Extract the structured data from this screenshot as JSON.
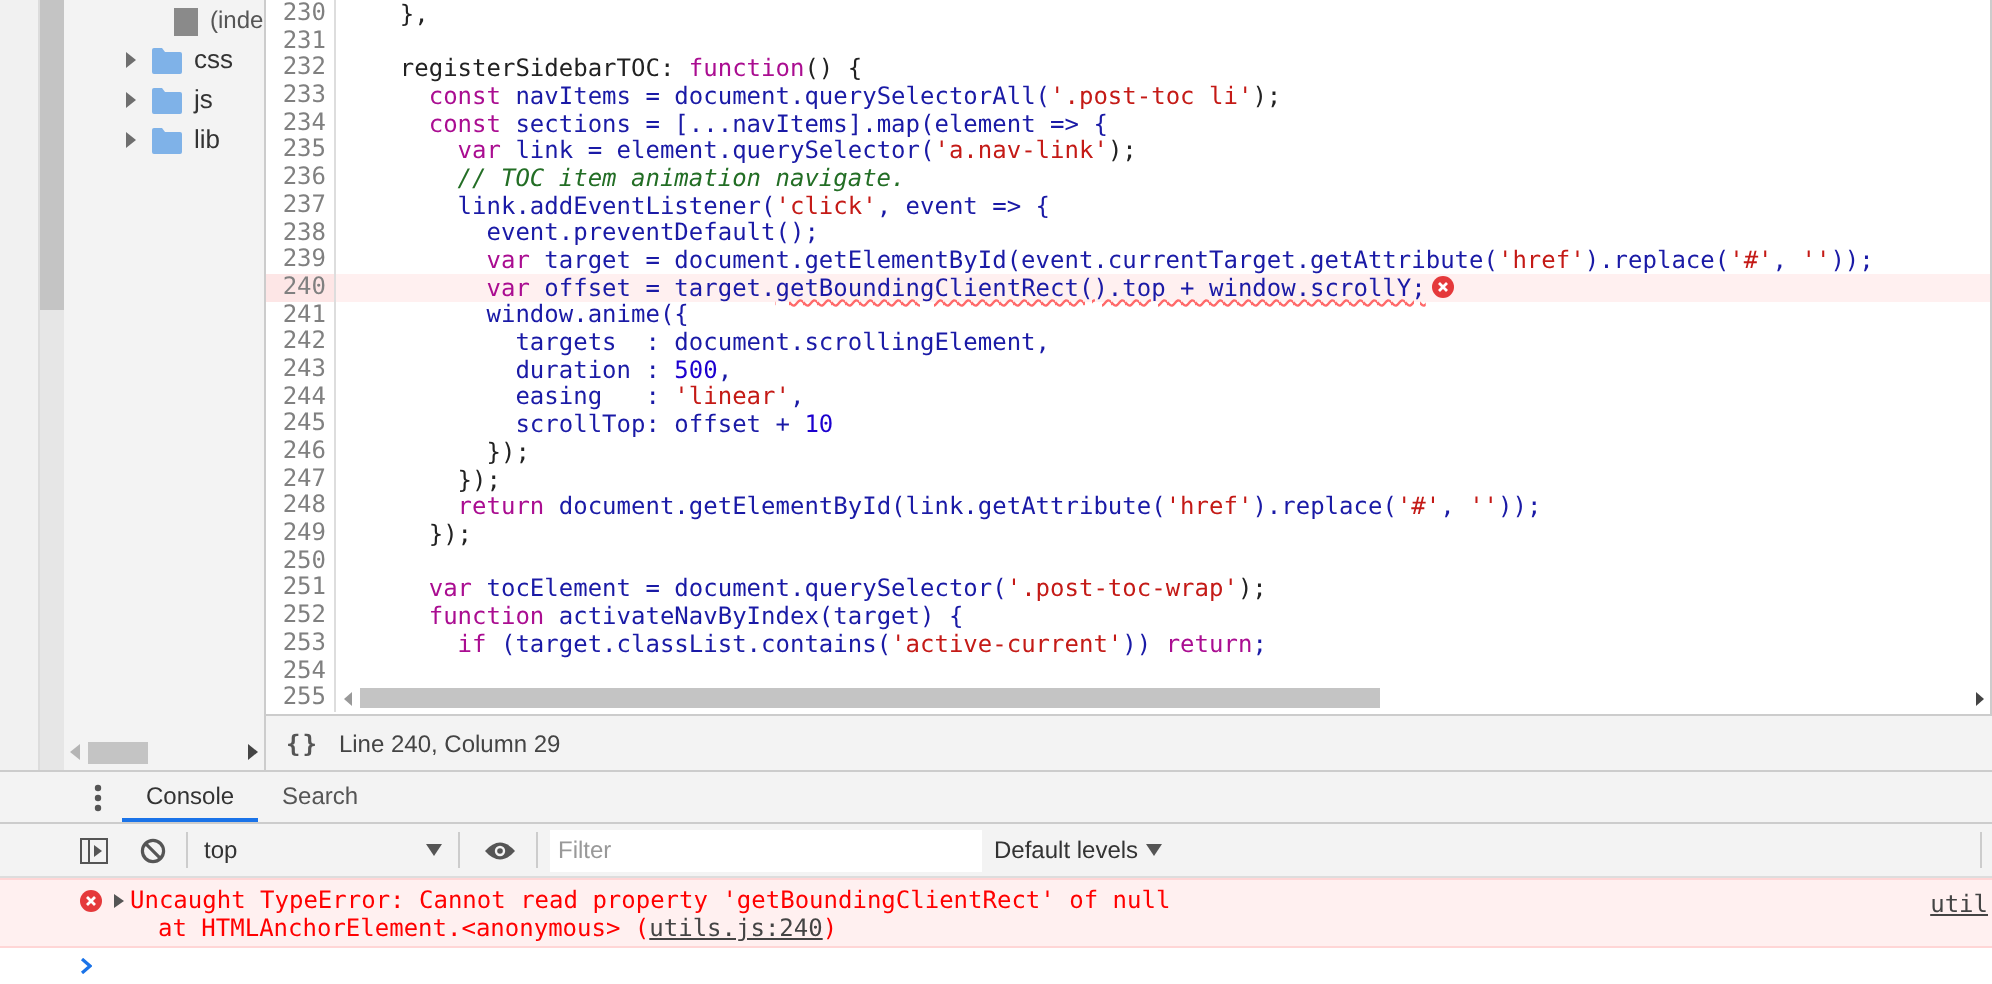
{
  "file_tree": {
    "partial_item": "(inde",
    "items": [
      {
        "label": "css",
        "expanded": false
      },
      {
        "label": "js",
        "expanded": false
      },
      {
        "label": "lib",
        "expanded": false
      }
    ]
  },
  "editor": {
    "lines": [
      {
        "number": "230",
        "tokens": [
          {
            "kind": "plain",
            "text": "    },"
          }
        ]
      },
      {
        "number": "231"
      },
      {
        "number": "232",
        "tokens": [
          {
            "kind": "plain",
            "text": "    registerSidebarTOC: "
          },
          {
            "kind": "keyword",
            "text": "function"
          },
          {
            "kind": "plain",
            "text": "() {"
          }
        ]
      },
      {
        "number": "233",
        "tokens": [
          {
            "kind": "keyword",
            "text": "      const"
          },
          {
            "kind": "name",
            "text": " navItems = document.querySelectorAll("
          },
          {
            "kind": "string",
            "text": "'.post-toc li'"
          },
          {
            "kind": "plain",
            "text": ");"
          }
        ]
      },
      {
        "number": "234",
        "tokens": [
          {
            "kind": "keyword",
            "text": "      const"
          },
          {
            "kind": "name",
            "text": " sections = [...navItems].map(element => {"
          }
        ]
      },
      {
        "number": "235",
        "tokens": [
          {
            "kind": "keyword",
            "text": "        var"
          },
          {
            "kind": "name",
            "text": " link = element.querySelector("
          },
          {
            "kind": "string",
            "text": "'a.nav-link'"
          },
          {
            "kind": "plain",
            "text": ");"
          }
        ]
      },
      {
        "number": "236",
        "tokens": [
          {
            "kind": "comment",
            "text": "        // TOC item animation navigate."
          }
        ]
      },
      {
        "number": "237",
        "tokens": [
          {
            "kind": "name",
            "text": "        link.addEventListener("
          },
          {
            "kind": "string",
            "text": "'click'"
          },
          {
            "kind": "name",
            "text": ", event => {"
          }
        ]
      },
      {
        "number": "238",
        "tokens": [
          {
            "kind": "name",
            "text": "          event.preventDefault();"
          }
        ]
      },
      {
        "number": "239",
        "tokens": [
          {
            "kind": "keyword",
            "text": "          var"
          },
          {
            "kind": "name",
            "text": " target = document.getElementById(event.currentTarget.getAttribute("
          },
          {
            "kind": "string",
            "text": "'href'"
          },
          {
            "kind": "name",
            "text": ").replace("
          },
          {
            "kind": "string",
            "text": "'#'"
          },
          {
            "kind": "name",
            "text": ", "
          },
          {
            "kind": "string",
            "text": "''"
          },
          {
            "kind": "name",
            "text": "));"
          }
        ]
      },
      {
        "number": "240",
        "error": true,
        "tokens": [
          {
            "kind": "keyword",
            "text": "          var"
          },
          {
            "kind": "name",
            "text": " offset = target."
          }
        ],
        "flagged_tokens": [
          {
            "kind": "name",
            "text": "getBoundingClientRect().top + window.scrollY;"
          }
        ]
      },
      {
        "number": "241",
        "tokens": [
          {
            "kind": "name",
            "text": "          window.anime({"
          }
        ]
      },
      {
        "number": "242",
        "tokens": [
          {
            "kind": "name",
            "text": "            targets  : document.scrollingElement,"
          }
        ]
      },
      {
        "number": "243",
        "tokens": [
          {
            "kind": "name",
            "text": "            duration : "
          },
          {
            "kind": "number",
            "text": "500"
          },
          {
            "kind": "name",
            "text": ","
          }
        ]
      },
      {
        "number": "244",
        "tokens": [
          {
            "kind": "name",
            "text": "            easing   : "
          },
          {
            "kind": "string",
            "text": "'linear'"
          },
          {
            "kind": "name",
            "text": ","
          }
        ]
      },
      {
        "number": "245",
        "tokens": [
          {
            "kind": "name",
            "text": "            scrollTop: offset + "
          },
          {
            "kind": "number",
            "text": "10"
          }
        ]
      },
      {
        "number": "246",
        "tokens": [
          {
            "kind": "plain",
            "text": "          });"
          }
        ]
      },
      {
        "number": "247",
        "tokens": [
          {
            "kind": "plain",
            "text": "        });"
          }
        ]
      },
      {
        "number": "248",
        "tokens": [
          {
            "kind": "keyword",
            "text": "        return"
          },
          {
            "kind": "name",
            "text": " document.getElementById(link.getAttribute("
          },
          {
            "kind": "string",
            "text": "'href'"
          },
          {
            "kind": "name",
            "text": ").replace("
          },
          {
            "kind": "string",
            "text": "'#'"
          },
          {
            "kind": "name",
            "text": ", "
          },
          {
            "kind": "string",
            "text": "''"
          },
          {
            "kind": "name",
            "text": "));"
          }
        ]
      },
      {
        "number": "249",
        "tokens": [
          {
            "kind": "plain",
            "text": "      });"
          }
        ]
      },
      {
        "number": "250"
      },
      {
        "number": "251",
        "tokens": [
          {
            "kind": "keyword",
            "text": "      var"
          },
          {
            "kind": "name",
            "text": " tocElement = document.querySelector("
          },
          {
            "kind": "string",
            "text": "'.post-toc-wrap'"
          },
          {
            "kind": "plain",
            "text": ");"
          }
        ]
      },
      {
        "number": "252",
        "tokens": [
          {
            "kind": "keyword",
            "text": "      function"
          },
          {
            "kind": "name",
            "text": " activateNavByIndex(target) {"
          }
        ]
      },
      {
        "number": "253",
        "tokens": [
          {
            "kind": "keyword",
            "text": "        if"
          },
          {
            "kind": "name",
            "text": " (target.classList.contains("
          },
          {
            "kind": "string",
            "text": "'active-current'"
          },
          {
            "kind": "name",
            "text": ")) "
          },
          {
            "kind": "keyword",
            "text": "return"
          },
          {
            "kind": "name",
            "text": ";"
          }
        ]
      },
      {
        "number": "254"
      },
      {
        "number": "255"
      }
    ],
    "format_button": "{}",
    "status": "Line 240, Column 29"
  },
  "drawer": {
    "tabs": [
      {
        "label": "Console",
        "selected": true
      },
      {
        "label": "Search",
        "selected": false
      }
    ],
    "toolbar": {
      "context": "top",
      "filter_placeholder": "Filter",
      "levels": "Default levels"
    },
    "messages": [
      {
        "kind": "error",
        "text": "Uncaught TypeError: Cannot read property 'getBoundingClientRect' of null",
        "trace_prefix": "at HTMLAnchorElement.<anonymous> (",
        "trace_link": "utils.js:240",
        "trace_suffix": ")",
        "source": "util"
      }
    ]
  }
}
